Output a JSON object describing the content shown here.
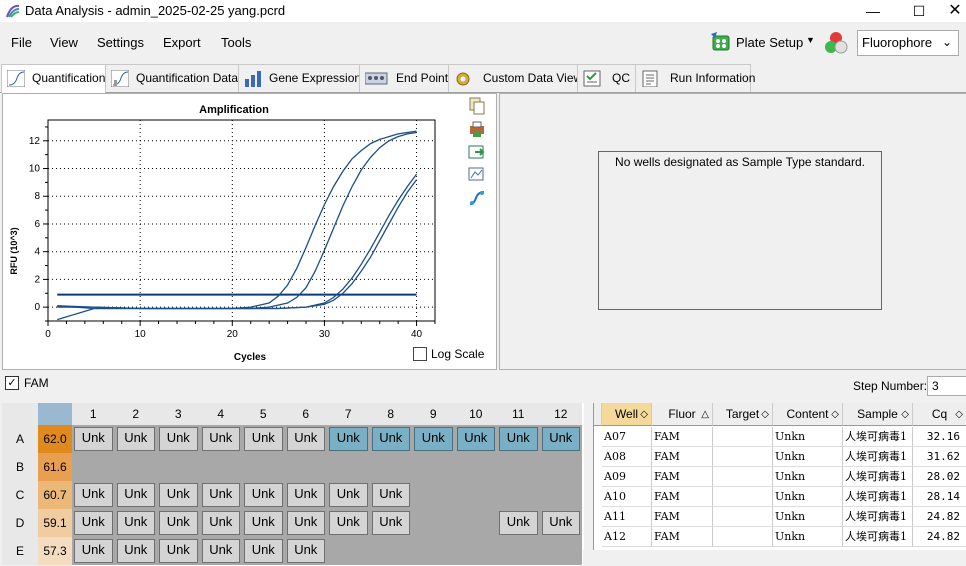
{
  "window": {
    "title": "Data Analysis - admin_2025-02-25 yang.pcrd"
  },
  "menu": [
    "File",
    "View",
    "Settings",
    "Export",
    "Tools"
  ],
  "toolbar": {
    "plate_setup": "Plate Setup",
    "fluorophore": "Fluorophore"
  },
  "tabs": [
    {
      "label": "Quantification",
      "active": true
    },
    {
      "label": "Quantification Data"
    },
    {
      "label": "Gene Expression"
    },
    {
      "label": "End Point"
    },
    {
      "label": "Custom Data View"
    },
    {
      "label": "QC"
    },
    {
      "label": "Run Information"
    }
  ],
  "chart": {
    "title": "Amplification",
    "xlabel": "Cycles",
    "ylabel": "RFU (10^3)",
    "log_scale_label": "Log Scale"
  },
  "chart_data": {
    "type": "line",
    "title": "Amplification",
    "xlabel": "Cycles",
    "ylabel": "RFU (10^3)",
    "xlim": [
      0,
      42
    ],
    "ylim": [
      -1,
      13.5
    ],
    "xticks": [
      0,
      10,
      20,
      30,
      40
    ],
    "yticks": [
      0,
      2,
      4,
      6,
      8,
      10,
      12
    ],
    "grid": true,
    "threshold": 0.9,
    "series": [
      {
        "x": [
          1,
          5,
          10,
          15,
          20,
          22,
          24,
          25,
          26,
          27,
          28,
          29,
          30,
          31,
          32,
          33,
          34,
          35,
          36,
          37,
          38,
          39,
          40
        ],
        "y": [
          0,
          0,
          -0.1,
          -0.1,
          -0.1,
          0,
          0.3,
          0.8,
          1.6,
          2.8,
          4.3,
          5.9,
          7.4,
          8.7,
          9.8,
          10.7,
          11.3,
          11.8,
          12.1,
          12.3,
          12.5,
          12.6,
          12.7
        ]
      },
      {
        "x": [
          1,
          5,
          10,
          15,
          20,
          22,
          24,
          26,
          27,
          28,
          29,
          30,
          31,
          32,
          33,
          34,
          35,
          36,
          37,
          38,
          39,
          40
        ],
        "y": [
          0.1,
          0,
          -0.1,
          -0.1,
          -0.1,
          -0.1,
          0,
          0.3,
          0.7,
          1.4,
          2.6,
          4.1,
          5.7,
          7.3,
          8.7,
          9.9,
          10.8,
          11.5,
          12,
          12.3,
          12.5,
          12.6
        ]
      },
      {
        "x": [
          1,
          5,
          10,
          15,
          20,
          25,
          28,
          30,
          31,
          32,
          33,
          34,
          35,
          36,
          37,
          38,
          39,
          40
        ],
        "y": [
          0.1,
          -0.1,
          -0.1,
          -0.1,
          -0.1,
          -0.1,
          0,
          0.3,
          0.7,
          1.3,
          2.1,
          3.1,
          4.2,
          5.4,
          6.6,
          7.7,
          8.7,
          9.6
        ]
      },
      {
        "x": [
          1,
          5,
          10,
          15,
          20,
          25,
          28,
          30,
          31,
          32,
          33,
          34,
          35,
          36,
          37,
          38,
          39,
          40
        ],
        "y": [
          -0.9,
          -0.1,
          -0.1,
          -0.1,
          -0.1,
          -0.1,
          0,
          0.2,
          0.5,
          1,
          1.7,
          2.6,
          3.6,
          4.8,
          6,
          7.2,
          8.3,
          9.2
        ]
      }
    ]
  },
  "right_panel": {
    "message": "No wells designated as Sample Type standard."
  },
  "fam": {
    "label": "FAM",
    "checked": true
  },
  "step": {
    "label": "Step Number:",
    "value": "3"
  },
  "plate": {
    "columns": [
      "1",
      "2",
      "3",
      "4",
      "5",
      "6",
      "7",
      "8",
      "9",
      "10",
      "11",
      "12"
    ],
    "rows": [
      {
        "label": "A",
        "value": "62.0",
        "color": "#e08a1e",
        "cells": [
          "Unk",
          "Unk",
          "Unk",
          "Unk",
          "Unk",
          "Unk",
          "Unk*",
          "Unk*",
          "Unk*",
          "Unk*",
          "Unk*",
          "Unk*"
        ]
      },
      {
        "label": "B",
        "value": "61.6",
        "color": "#e8a050",
        "cells": [
          "",
          "",
          "",
          "",
          "",
          "",
          "",
          "",
          "",
          "",
          "",
          ""
        ]
      },
      {
        "label": "C",
        "value": "60.7",
        "color": "#ecb878",
        "cells": [
          "Unk",
          "Unk",
          "Unk",
          "Unk",
          "Unk",
          "Unk",
          "Unk",
          "Unk",
          "",
          "",
          "",
          ""
        ]
      },
      {
        "label": "D",
        "value": "59.1",
        "color": "#f0cca0",
        "cells": [
          "Unk",
          "Unk",
          "Unk",
          "Unk",
          "Unk",
          "Unk",
          "Unk",
          "Unk",
          "",
          "",
          "Unk",
          "Unk"
        ]
      },
      {
        "label": "E",
        "value": "57.3",
        "color": "#f3dcc0",
        "cells": [
          "Unk",
          "Unk",
          "Unk",
          "Unk",
          "Unk",
          "Unk",
          "",
          "",
          "",
          "",
          "",
          ""
        ]
      }
    ]
  },
  "well_table": {
    "headers": [
      "Well",
      "Fluor",
      "Target",
      "Content",
      "Sample",
      "Cq"
    ],
    "rows": [
      [
        "A07",
        "FAM",
        "",
        "Unkn",
        "人埃可病毒1",
        "32.16"
      ],
      [
        "A08",
        "FAM",
        "",
        "Unkn",
        "人埃可病毒1",
        "31.62"
      ],
      [
        "A09",
        "FAM",
        "",
        "Unkn",
        "人埃可病毒1",
        "28.02"
      ],
      [
        "A10",
        "FAM",
        "",
        "Unkn",
        "人埃可病毒1",
        "28.14"
      ],
      [
        "A11",
        "FAM",
        "",
        "Unkn",
        "人埃可病毒1",
        "24.82"
      ],
      [
        "A12",
        "FAM",
        "",
        "Unkn",
        "人埃可病毒1",
        "24.82"
      ]
    ]
  }
}
